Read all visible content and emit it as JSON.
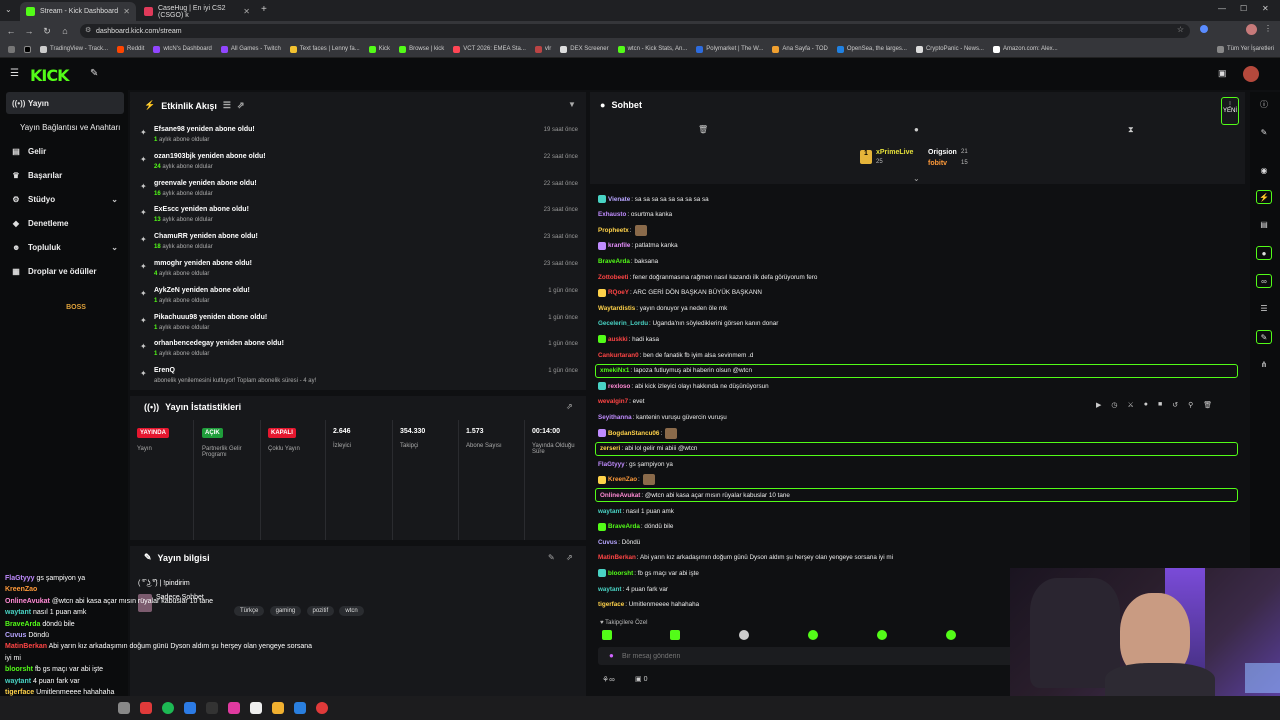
{
  "browser": {
    "tabs": [
      {
        "title": "Stream - Kick Dashboard",
        "color": "#53fc18"
      },
      {
        "title": "CaseHug | En iyi CS2 (CSGO) k",
        "color": "#e03a5a"
      }
    ],
    "url": "dashboard.kick.com/stream",
    "bookmarks": [
      "TradingView - Track...",
      "Reddit",
      "wtcN's Dashboard",
      "All Games - Twitch",
      "Text faces | Lenny fa...",
      "Kick",
      "Browse | kick",
      "VCT 2026: EMEA Sta...",
      "vlr",
      "DEX Screener",
      "wtcn - Kick Stats, An...",
      "Polymarket | The W...",
      "Ana Sayfa - TOD",
      "OpenSea, the larges...",
      "CryptoPanic - News...",
      "Amazon.com: Alex..."
    ],
    "all_bookmarks": "Tüm Yer İşaretleri"
  },
  "sidebar": {
    "items": [
      {
        "label": "Yayın",
        "icon": "radio-icon"
      },
      {
        "label": "Yayın Bağlantısı ve Anahtarı",
        "icon": ""
      },
      {
        "label": "Gelir",
        "icon": "money-icon"
      },
      {
        "label": "Başarılar",
        "icon": "trophy-icon"
      },
      {
        "label": "Stüdyo",
        "icon": "studio-icon"
      },
      {
        "label": "Denetleme",
        "icon": "shield-icon"
      },
      {
        "label": "Topluluk",
        "icon": "community-icon"
      },
      {
        "label": "Droplar ve ödüller",
        "icon": "gift-icon"
      }
    ],
    "boss_label": "BOSS"
  },
  "activity": {
    "title": "Etkinlik Akışı",
    "events": [
      {
        "title": "Efsane98 yeniden abone oldu!",
        "count": "1",
        "sub": " aylık abone oldular",
        "time": "19 saat önce"
      },
      {
        "title": "ozan1903bjk yeniden abone oldu!",
        "count": "24",
        "sub": " aylık abone oldular",
        "time": "22 saat önce"
      },
      {
        "title": "greenvale yeniden abone oldu!",
        "count": "16",
        "sub": " aylık abone oldular",
        "time": "22 saat önce"
      },
      {
        "title": "ExEscc yeniden abone oldu!",
        "count": "13",
        "sub": " aylık abone oldular",
        "time": "23 saat önce"
      },
      {
        "title": "ChamuRR yeniden abone oldu!",
        "count": "18",
        "sub": " aylık abone oldular",
        "time": "23 saat önce"
      },
      {
        "title": "mmoghr yeniden abone oldu!",
        "count": "4",
        "sub": " aylık abone oldular",
        "time": "23 saat önce"
      },
      {
        "title": "AykZeN yeniden abone oldu!",
        "count": "1",
        "sub": " aylık abone oldular",
        "time": "1 gün önce"
      },
      {
        "title": "Pikachuuu98 yeniden abone oldu!",
        "count": "1",
        "sub": " aylık abone oldular",
        "time": "1 gün önce"
      },
      {
        "title": "orhanbencedegay yeniden abone oldu!",
        "count": "1",
        "sub": " aylık abone oldular",
        "time": "1 gün önce"
      },
      {
        "title": "ErenQ",
        "count": "",
        "sub": "abonelik yenilemesini kutluyor! Toplam abonelik süresi - 4 ay!",
        "time": "1 gün önce"
      }
    ]
  },
  "stats": {
    "title": "Yayın İstatistikleri",
    "items": [
      {
        "badge": "YAYINDA",
        "badge_color": "#e5172f",
        "label": "Yayın"
      },
      {
        "badge": "AÇIK",
        "badge_color": "#1f9d3b",
        "label": "Partnerlik Gelir Programı"
      },
      {
        "badge": "KAPALI",
        "badge_color": "#e5172f",
        "label": "Çoklu Yayın"
      },
      {
        "value": "2.646",
        "label": "İzleyici"
      },
      {
        "value": "354.330",
        "label": "Takipçi"
      },
      {
        "value": "1.573",
        "label": "Abone Sayısı"
      },
      {
        "value": "00:14:00",
        "label": "Yayında Olduğu Süre"
      }
    ]
  },
  "info": {
    "title": "Yayın bilgisi",
    "stream_title": "( ͡° ͜ʖ ͡°) | !pindirim",
    "category": "Sadece Sohbet",
    "tags": [
      "Türkçe",
      "gaming",
      "pozitif",
      "wtcn"
    ]
  },
  "chat": {
    "title": "Sohbet",
    "new_label": "YENİ",
    "pinned": {
      "name": "xPrimeLive",
      "count": "25",
      "name2": "Origsion",
      "count2": "21",
      "name3": "fobitv",
      "count3": "15"
    },
    "messages": [
      {
        "user": "Vienate",
        "color": "#b7a5ff",
        "text": ": sa sa sa sa sa sa sa sa sa",
        "hl": false
      },
      {
        "user": "Exhausto",
        "color": "#c08cff",
        "text": ": osurtma kanka",
        "hl": false
      },
      {
        "user": "Propheetx",
        "color": "#ffd24a",
        "text": ":",
        "hl": false,
        "emote": true
      },
      {
        "user": "kranfile",
        "color": "#e890ff",
        "text": ": patlatma kanka",
        "hl": false
      },
      {
        "user": "BraveArda",
        "color": "#53fc18",
        "text": ": baksana",
        "hl": false
      },
      {
        "user": "Zottobeeti",
        "color": "#ff4545",
        "text": ": fener doğranmasına rağmen nasıl kazandı ilk defa görüyorum fero",
        "hl": false
      },
      {
        "user": "RQoeY",
        "color": "#ff4545",
        "text": ": ARC GERİ DÖN BAŞKAN BÜYÜK BAŞKANN",
        "hl": false
      },
      {
        "user": "Waytardistis",
        "color": "#ffd24a",
        "text": ": yayın donuyor ya neden öle mk",
        "hl": false
      },
      {
        "user": "Gecelerin_Lordu",
        "color": "#49d3c4",
        "text": ": Uganda'nın söylediklerini görsen kanın donar",
        "hl": false
      },
      {
        "user": "auskki",
        "color": "#ff4545",
        "text": ": hadi kasa",
        "hl": false
      },
      {
        "user": "Cankurtaran0",
        "color": "#ff4545",
        "text": ": ben de fanatik fb iyim alsa sevinmem .d",
        "hl": false
      },
      {
        "user": "xmekiNx1",
        "color": "#53fc18",
        "text": ": lapoza futluymuş abi haberin olsun @wtcn",
        "hl": true
      },
      {
        "user": "rexloso",
        "color": "#ff8ad4",
        "text": ": abi kick izleyici olayı hakkında ne düşünüyorsun",
        "hl": false
      },
      {
        "user": "wevalgin7",
        "color": "#ff4545",
        "text": ": evet",
        "hl": false
      },
      {
        "user": "Seyithanna",
        "color": "#c08cff",
        "text": ": kantenin vuruşu güvercin vuruşu",
        "hl": false
      },
      {
        "user": "BogdanStancu06",
        "color": "#ffd24a",
        "text": ":",
        "hl": false,
        "emote": true
      },
      {
        "user": "zerseri",
        "color": "#ffd24a",
        "text": ": abi lol gelir mi abiii @wtcn",
        "hl": true
      },
      {
        "user": "FlaGtyyy",
        "color": "#c08cff",
        "text": ": gs şampiyon ya",
        "hl": false
      },
      {
        "user": "KreenZao",
        "color": "#ff9a3a",
        "text": ":",
        "hl": false,
        "emote": true
      },
      {
        "user": "OnlineAvukat",
        "color": "#ff8ad4",
        "text": ": @wtcn abi kasa açar mısın rüyalar kabuslar 10 tane",
        "hl": true
      },
      {
        "user": "waytant",
        "color": "#49d3c4",
        "text": ": nasıl 1 puan amk",
        "hl": false
      },
      {
        "user": "BraveArda",
        "color": "#53fc18",
        "text": ": döndü bile",
        "hl": false
      },
      {
        "user": "Cuvus",
        "color": "#b7a5ff",
        "text": ": Döndü",
        "hl": false
      },
      {
        "user": "MatinBerkan",
        "color": "#ff4545",
        "text": ": Abi yarın kız arkadaşımın doğum günü Dyson aldım şu herşey olan yengeye sorsana iyi mi",
        "hl": false
      },
      {
        "user": "bloorsht",
        "color": "#53fc18",
        "text": ": fb gs maçı var abi işte",
        "hl": false
      },
      {
        "user": "waytant",
        "color": "#49d3c4",
        "text": ": 4 puan fark var",
        "hl": false
      },
      {
        "user": "tigerface",
        "color": "#ffd24a",
        "text": ": Umitlenmeeee hahahaha",
        "hl": false
      }
    ],
    "followers_only": "Takipçilere Özel",
    "placeholder": "Bir mesaj gönderin",
    "points": "0"
  },
  "overlay": {
    "lines": [
      {
        "user": "FlaGtyyy",
        "color": "#c08cff",
        "text": "gs şampiyon ya"
      },
      {
        "user": "KreenZao",
        "color": "#ff9a3a",
        "text": ""
      },
      {
        "user": "OnlineAvukat",
        "color": "#ff8ad4",
        "text": "@wtcn abi kasa açar mısın rüyalar kabuslar 10 tane"
      },
      {
        "user": "waytant",
        "color": "#49d3c4",
        "text": "nasıl 1 puan amk"
      },
      {
        "user": "BraveArda",
        "color": "#53fc18",
        "text": "döndü bile"
      },
      {
        "user": "Cuvus",
        "color": "#b7a5ff",
        "text": "Döndü"
      },
      {
        "user": "MatinBerkan",
        "color": "#ff4545",
        "text": "Abi yarın kız arkadaşımın doğum günü Dyson aldım şu herşey olan yengeye sorsana"
      },
      {
        "user": "",
        "color": "#ffffff",
        "text": "iyi mi"
      },
      {
        "user": "bloorsht",
        "color": "#53fc18",
        "text": "fb gs maçı var abi işte"
      },
      {
        "user": "waytant",
        "color": "#49d3c4",
        "text": "4 puan fark var"
      },
      {
        "user": "tigerface",
        "color": "#ffd24a",
        "text": "Umitlenmeeee hahahaha"
      }
    ]
  }
}
